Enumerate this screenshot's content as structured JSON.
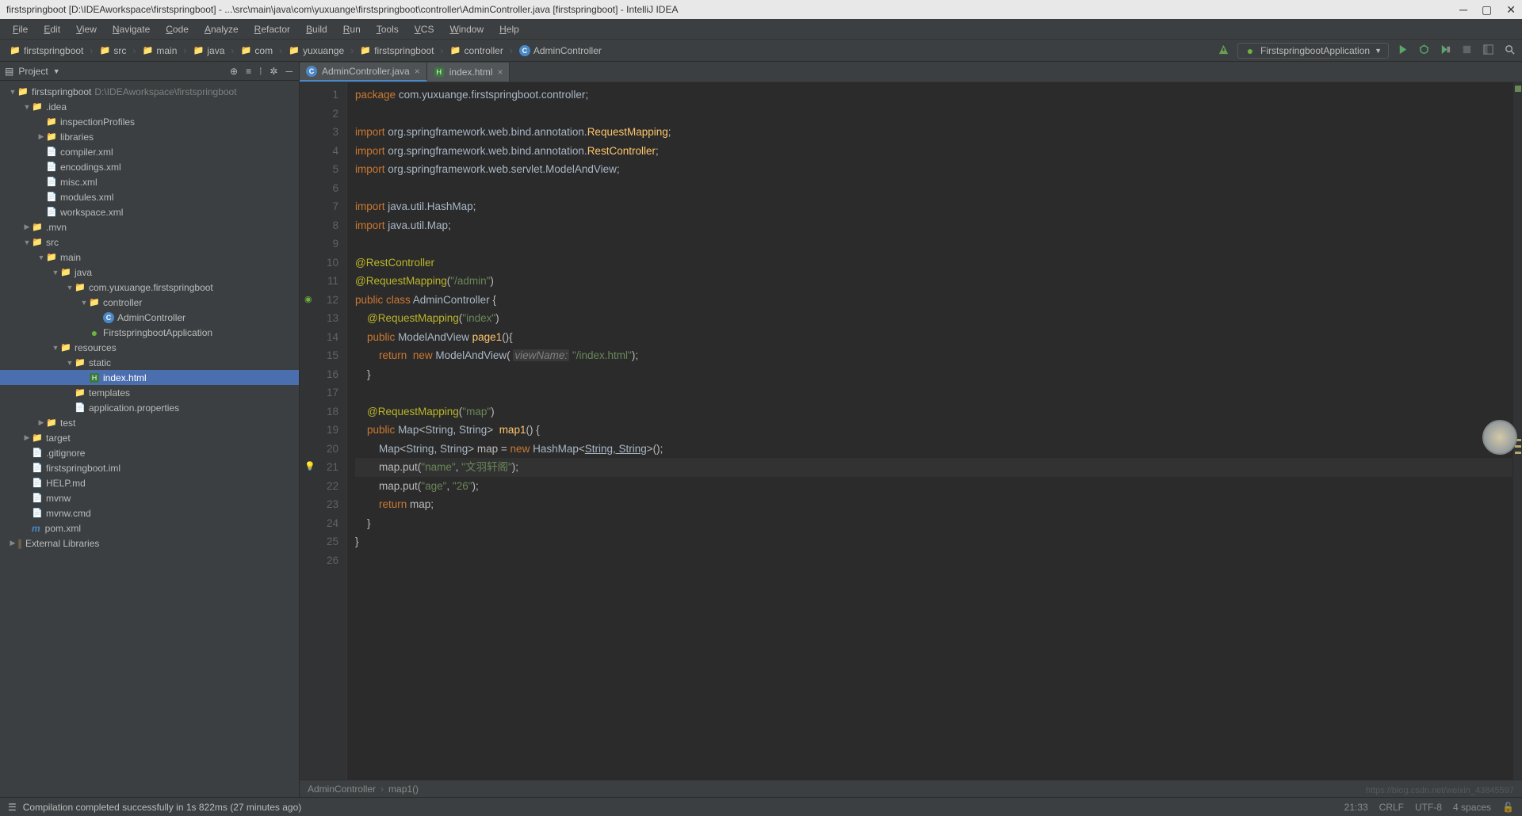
{
  "title": "firstspringboot [D:\\IDEAworkspace\\firstspringboot] - ...\\src\\main\\java\\com\\yuxuange\\firstspringboot\\controller\\AdminController.java [firstspringboot] - IntelliJ IDEA",
  "menu": [
    "File",
    "Edit",
    "View",
    "Navigate",
    "Code",
    "Analyze",
    "Refactor",
    "Build",
    "Run",
    "Tools",
    "VCS",
    "Window",
    "Help"
  ],
  "breadcrumbs": [
    {
      "icon": "fld-blue",
      "label": "firstspringboot"
    },
    {
      "icon": "fld-blue",
      "label": "src"
    },
    {
      "icon": "fld-blue",
      "label": "main"
    },
    {
      "icon": "fld-blue",
      "label": "java"
    },
    {
      "icon": "fld-blue",
      "label": "com"
    },
    {
      "icon": "fld-blue",
      "label": "yuxuange"
    },
    {
      "icon": "fld-blue",
      "label": "firstspringboot"
    },
    {
      "icon": "fld-blue",
      "label": "controller"
    },
    {
      "icon": "cls",
      "label": "AdminController"
    }
  ],
  "runConfig": "FirstspringbootApplication",
  "projectPanel": {
    "title": "Project"
  },
  "tree": [
    {
      "d": 0,
      "a": "▼",
      "ic": "fld-blue",
      "l": "firstspringboot",
      "s": "D:\\IDEAworkspace\\firstspringboot"
    },
    {
      "d": 1,
      "a": "▼",
      "ic": "fld-gray",
      "l": ".idea"
    },
    {
      "d": 2,
      "a": "",
      "ic": "fld-gray",
      "l": "inspectionProfiles"
    },
    {
      "d": 2,
      "a": "▶",
      "ic": "fld-gray",
      "l": "libraries"
    },
    {
      "d": 2,
      "a": "",
      "ic": "file-x",
      "l": "compiler.xml"
    },
    {
      "d": 2,
      "a": "",
      "ic": "file-x",
      "l": "encodings.xml"
    },
    {
      "d": 2,
      "a": "",
      "ic": "file-x",
      "l": "misc.xml"
    },
    {
      "d": 2,
      "a": "",
      "ic": "file-x",
      "l": "modules.xml"
    },
    {
      "d": 2,
      "a": "",
      "ic": "file-x",
      "l": "workspace.xml"
    },
    {
      "d": 1,
      "a": "▶",
      "ic": "fld-gray",
      "l": ".mvn"
    },
    {
      "d": 1,
      "a": "▼",
      "ic": "fld-blue",
      "l": "src"
    },
    {
      "d": 2,
      "a": "▼",
      "ic": "fld-blue",
      "l": "main"
    },
    {
      "d": 3,
      "a": "▼",
      "ic": "fld-blue",
      "l": "java"
    },
    {
      "d": 4,
      "a": "▼",
      "ic": "fld-gray",
      "l": "com.yuxuange.firstspringboot"
    },
    {
      "d": 5,
      "a": "▼",
      "ic": "fld-gray",
      "l": "controller"
    },
    {
      "d": 6,
      "a": "",
      "ic": "cls",
      "l": "AdminController"
    },
    {
      "d": 5,
      "a": "",
      "ic": "spring",
      "l": "FirstspringbootApplication"
    },
    {
      "d": 3,
      "a": "▼",
      "ic": "fld-gray",
      "l": "resources"
    },
    {
      "d": 4,
      "a": "▼",
      "ic": "fld-gray",
      "l": "static"
    },
    {
      "d": 5,
      "a": "",
      "ic": "html-ic",
      "l": "index.html",
      "sel": true
    },
    {
      "d": 4,
      "a": "",
      "ic": "fld-gray",
      "l": "templates"
    },
    {
      "d": 4,
      "a": "",
      "ic": "file-x",
      "l": "application.properties"
    },
    {
      "d": 2,
      "a": "▶",
      "ic": "fld-blue",
      "l": "test"
    },
    {
      "d": 1,
      "a": "▶",
      "ic": "fld-orange",
      "l": "target"
    },
    {
      "d": 1,
      "a": "",
      "ic": "file-x",
      "l": ".gitignore"
    },
    {
      "d": 1,
      "a": "",
      "ic": "file-x",
      "l": "firstspringboot.iml"
    },
    {
      "d": 1,
      "a": "",
      "ic": "file-x",
      "l": "HELP.md"
    },
    {
      "d": 1,
      "a": "",
      "ic": "file-x",
      "l": "mvnw"
    },
    {
      "d": 1,
      "a": "",
      "ic": "file-x",
      "l": "mvnw.cmd"
    },
    {
      "d": 1,
      "a": "",
      "ic": "file-x",
      "l": "pom.xml",
      "m": true
    },
    {
      "d": 0,
      "a": "▶",
      "ic": "fld-gray",
      "l": "External Libraries",
      "lib": true
    }
  ],
  "tabs": [
    {
      "ic": "cls",
      "l": "AdminController.java",
      "active": true
    },
    {
      "ic": "html-ic",
      "l": "index.html"
    }
  ],
  "code": {
    "lines": [
      {
        "n": 1,
        "h": "<span class='kw'>package</span> <span class='pkg'>com.yuxuange.firstspringboot.controller</span>;"
      },
      {
        "n": 2,
        "h": ""
      },
      {
        "n": 3,
        "h": "<span class='kw'>import</span> <span class='pkg'>org.springframework.web.bind.annotation.</span><span class='fn'>RequestMapping</span>;"
      },
      {
        "n": 4,
        "h": "<span class='kw'>import</span> <span class='pkg'>org.springframework.web.bind.annotation.</span><span class='fn'>RestController</span>;"
      },
      {
        "n": 5,
        "h": "<span class='kw'>import</span> <span class='pkg'>org.springframework.web.servlet.ModelAndView</span>;"
      },
      {
        "n": 6,
        "h": ""
      },
      {
        "n": 7,
        "h": "<span class='kw'>import</span> <span class='pkg'>java.util.HashMap</span>;"
      },
      {
        "n": 8,
        "h": "<span class='kw'>import</span> <span class='pkg'>java.util.Map</span>;"
      },
      {
        "n": 9,
        "h": ""
      },
      {
        "n": 10,
        "h": "<span class='ann'>@RestController</span>"
      },
      {
        "n": 11,
        "h": "<span class='ann'>@RequestMapping</span>(<span class='str'>\"/admin\"</span>)"
      },
      {
        "n": 12,
        "h": "<span class='kw'>public class</span> <span class='cls-t'>AdminController</span> {",
        "gic": "spring"
      },
      {
        "n": 13,
        "h": "    <span class='ann'>@RequestMapping</span>(<span class='str'>\"index\"</span>)"
      },
      {
        "n": 14,
        "h": "    <span class='kw'>public</span> <span class='cls-t'>ModelAndView</span> <span class='fn'>page1</span>(){"
      },
      {
        "n": 15,
        "h": "        <span class='kw'>return</span>  <span class='kw'>new</span> <span class='cls-t'>ModelAndView</span>( <span class='param'>viewName:</span> <span class='str'>\"/index.html\"</span>);"
      },
      {
        "n": 16,
        "h": "    }"
      },
      {
        "n": 17,
        "h": ""
      },
      {
        "n": 18,
        "h": "    <span class='ann'>@RequestMapping</span>(<span class='str'>\"map\"</span>)"
      },
      {
        "n": 19,
        "h": "    <span class='kw'>public</span> <span class='cls-t'>Map</span>&lt;<span class='cls-t'>String</span>, <span class='cls-t'>String</span>&gt;  <span class='fn'>map1</span>() {"
      },
      {
        "n": 20,
        "h": "        <span class='cls-t'>Map</span>&lt;<span class='cls-t'>String</span>, <span class='cls-t'>String</span>&gt; map = <span class='kw'>new</span> <span class='cls-t'>HashMap</span>&lt;<span class='cls-t' style='text-decoration:underline'>String, String</span>&gt;();"
      },
      {
        "n": 21,
        "h": "        map.put(<span class='str'>\"name\"</span>, <span class='str'>\"文羽轩阁\"</span>);",
        "hl": true,
        "gic": "bulb"
      },
      {
        "n": 22,
        "h": "        map.put(<span class='str'>\"age\"</span>, <span class='str'>\"26\"</span>);"
      },
      {
        "n": 23,
        "h": "        <span class='kw'>return</span> map;"
      },
      {
        "n": 24,
        "h": "    }"
      },
      {
        "n": 25,
        "h": "}"
      },
      {
        "n": 26,
        "h": ""
      }
    ]
  },
  "editorCrumbs": [
    "AdminController",
    "map1()"
  ],
  "status": {
    "msg": "Compilation completed successfully in 1s 822ms (27 minutes ago)",
    "pos": "21:33",
    "enc": "CRLF",
    "charset": "UTF-8",
    "ind": "4 spaces"
  },
  "watermark": "https://blog.csdn.net/weixin_43845597"
}
